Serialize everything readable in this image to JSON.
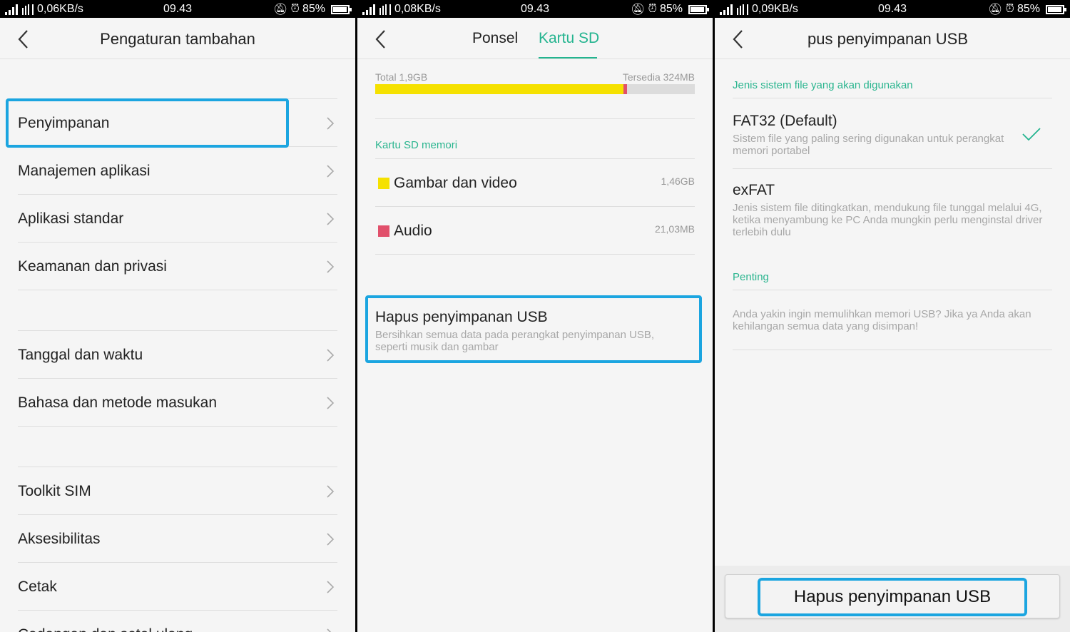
{
  "colors": {
    "accent": "#23b48f",
    "highlight": "#1ba5e0",
    "images_swatch": "#f5e100",
    "audio_swatch": "#e1506b"
  },
  "panels": [
    {
      "status": {
        "speed": "0,06KB/s",
        "time": "09.43",
        "battery": "85%"
      },
      "title": "Pengaturan tambahan",
      "items": [
        {
          "label": "Penyimpanan"
        },
        {
          "label": "Manajemen aplikasi"
        },
        {
          "label": "Aplikasi standar"
        },
        {
          "label": "Keamanan dan privasi"
        },
        {
          "label": "Tanggal dan waktu"
        },
        {
          "label": "Bahasa dan metode masukan"
        },
        {
          "label": "Toolkit SIM"
        },
        {
          "label": "Aksesibilitas"
        },
        {
          "label": "Cetak"
        },
        {
          "label": "Cadangan dan setel ulang"
        }
      ]
    },
    {
      "status": {
        "speed": "0,08KB/s",
        "time": "09.43",
        "battery": "85%"
      },
      "tabs": [
        {
          "label": "Ponsel"
        },
        {
          "label": "Kartu SD",
          "selected": true
        }
      ],
      "total": "Total 1,9GB",
      "available": "Tersedia 324MB",
      "used_fraction": 0.78,
      "section": "Kartu SD memori",
      "categories": [
        {
          "label": "Gambar dan video",
          "size": "1,46GB"
        },
        {
          "label": "Audio",
          "size": "21,03MB"
        }
      ],
      "erase": {
        "title": "Hapus penyimpanan USB",
        "desc": "Bersihkan semua data pada perangkat penyimpanan USB, seperti musik dan gambar"
      }
    },
    {
      "status": {
        "speed": "0,09KB/s",
        "time": "09.43",
        "battery": "85%"
      },
      "title": "pus penyimpanan USB",
      "fs_section": "Jenis sistem file yang akan digunakan",
      "options": [
        {
          "name": "FAT32 (Default)",
          "desc": "Sistem file yang paling sering digunakan untuk perangkat memori portabel",
          "selected": true
        },
        {
          "name": "exFAT",
          "desc": "Jenis sistem file ditingkatkan, mendukung file tunggal melalui 4G, ketika menyambung ke PC Anda mungkin perlu menginstal driver terlebih dulu"
        }
      ],
      "important_section": "Penting",
      "warning": "Anda yakin ingin memulihkan memori USB? Jika ya Anda akan kehilangan semua data yang disimpan!",
      "button": "Hapus penyimpanan USB"
    }
  ]
}
